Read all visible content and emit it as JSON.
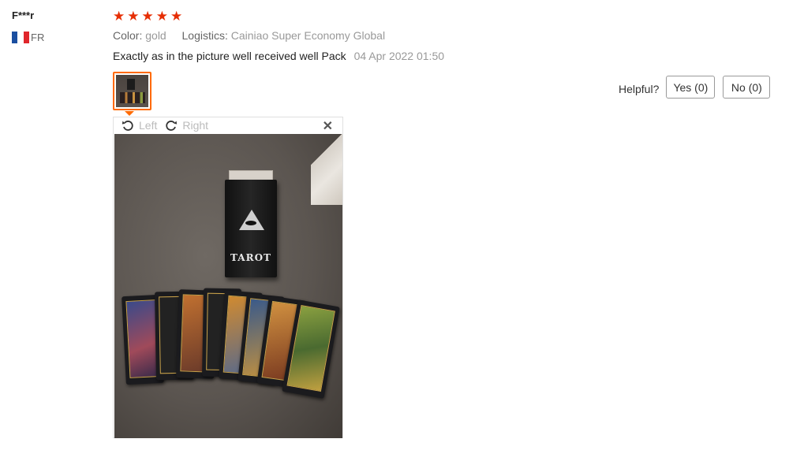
{
  "reviewer": {
    "name": "F***r",
    "country_code": "FR",
    "flag_colors": [
      "#1a4fa0",
      "#ffffff",
      "#e0262b"
    ]
  },
  "rating": {
    "stars": 5,
    "max": 5,
    "color": "#e62e04"
  },
  "attributes": {
    "color_label": "Color:",
    "color_value": "gold",
    "logistics_label": "Logistics:",
    "logistics_value": "Cainiao Super Economy Global"
  },
  "review": {
    "text": "Exactly as in the picture well received well Pack",
    "date": "04 Apr 2022 01:50"
  },
  "helpful": {
    "label": "Helpful?",
    "yes_label": "Yes (0)",
    "no_label": "No (0)"
  },
  "viewer": {
    "rotate_left_label": "Left",
    "rotate_right_label": "Right",
    "close_icon": "close-icon",
    "box_text": "TAROT"
  },
  "accent_color": "#ff6a00"
}
